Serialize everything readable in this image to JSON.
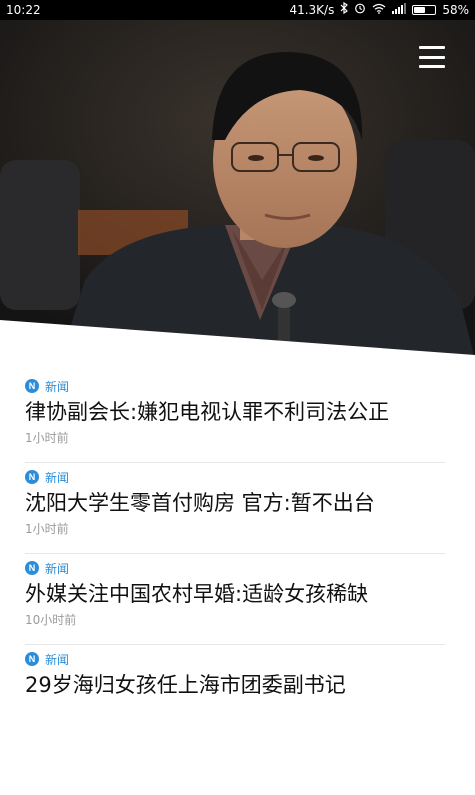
{
  "status_bar": {
    "time": "10:22",
    "network_speed": "41.3K/s",
    "battery": "58%",
    "battery_level": 0.58,
    "icons": [
      "bluetooth-icon",
      "alarm-icon",
      "wifi-icon",
      "signal-icon",
      "battery-icon"
    ]
  },
  "hero": {
    "image": "person-photo"
  },
  "menu": {
    "icon": "hamburger-menu-icon"
  },
  "news": [
    {
      "category": "新闻",
      "category_icon": "N",
      "title": "律协副会长:嫌犯电视认罪不利司法公正",
      "time": "1小时前"
    },
    {
      "category": "新闻",
      "category_icon": "N",
      "title": "沈阳大学生零首付购房 官方:暂不出台",
      "time": "1小时前"
    },
    {
      "category": "新闻",
      "category_icon": "N",
      "title": "外媒关注中国农村早婚:适龄女孩稀缺",
      "time": "10小时前"
    },
    {
      "category": "新闻",
      "category_icon": "N",
      "title": "29岁海归女孩任上海市团委副书记",
      "time": ""
    }
  ],
  "colors": {
    "accent": "#2b8dd9",
    "headline": "#111111",
    "meta": "#9a9a9a"
  }
}
